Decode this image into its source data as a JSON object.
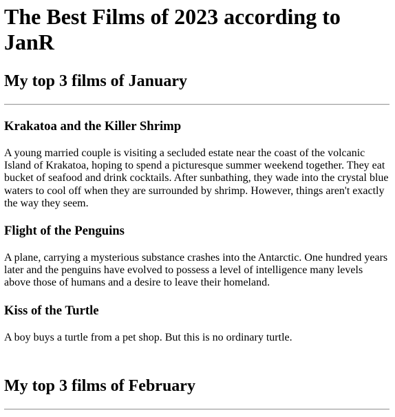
{
  "page": {
    "title": "The Best Films of 2023 according to JanR"
  },
  "sections": [
    {
      "heading": "My top 3 films of January",
      "films": [
        {
          "title": "Krakatoa and the Killer Shrimp",
          "description": "A young married couple is visiting a secluded estate near the coast of the volcanic Island of Krakatoa, hoping to spend a picturesque summer weekend together. They eat bucket of seafood and drink cocktails. After sunbathing, they wade into the crystal blue waters to cool off when they are surrounded by shrimp. However, things aren't exactly the way they seem."
        },
        {
          "title": "Flight of the Penguins",
          "description": "A plane, carrying a mysterious substance crashes into the Antarctic. One hundred years later and the penguins have evolved to possess a level of intelligence many levels above those of humans and a desire to leave their homeland."
        },
        {
          "title": "Kiss of the Turtle",
          "description": "A boy buys a turtle from a pet shop. But this is no ordinary turtle."
        }
      ]
    },
    {
      "heading": "My top 3 films of February"
    }
  ]
}
